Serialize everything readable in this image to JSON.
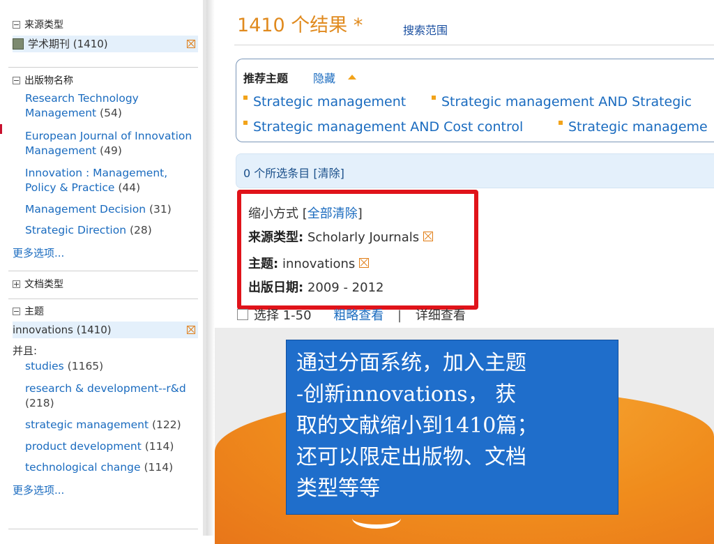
{
  "sidebar": {
    "source_type": {
      "heading": "来源类型",
      "selected": "学术期刊 (1410)"
    },
    "publication": {
      "heading": "出版物名称",
      "items": [
        {
          "label": "Research Technology Management",
          "count": "(54)"
        },
        {
          "label": "European Journal of Innovation Management",
          "count": "(49)"
        },
        {
          "label": "Innovation : Management, Policy & Practice",
          "count": "(44)"
        },
        {
          "label": "Management Decision",
          "count": "(31)"
        },
        {
          "label": "Strategic Direction",
          "count": "(28)"
        }
      ],
      "more": "更多选项..."
    },
    "doc_type": {
      "heading": "文档类型"
    },
    "subject": {
      "heading": "主题",
      "selected": "innovations (1410)",
      "and_label": "并且:",
      "items": [
        {
          "label": "studies",
          "count": "(1165)"
        },
        {
          "label": "research & development--r&d",
          "count": "(218)"
        },
        {
          "label": "strategic management",
          "count": "(122)"
        },
        {
          "label": "product development",
          "count": "(114)"
        },
        {
          "label": "technological change",
          "count": "(114)"
        }
      ],
      "more": "更多选项..."
    }
  },
  "main": {
    "results_count": "1410 个结果 *",
    "search_scope": "搜索范围",
    "recommended": {
      "title": "推荐主题",
      "hide": "隐藏",
      "topics": [
        "Strategic management",
        "Strategic management AND Strategic",
        "Strategic management AND Cost control",
        "Strategic manageme"
      ]
    },
    "selected_items": "0 个所选条目 [清除]",
    "narrow": {
      "title_prefix": "缩小方式 [",
      "clear_all": "全部清除",
      "title_suffix": "]",
      "source_type_label": "来源类型:",
      "source_type_value": "Scholarly Journals",
      "subject_label": "主题:",
      "subject_value": "innovations",
      "date_label": "出版日期:",
      "date_value": "2009 - 2012"
    },
    "select_range": "选择 1-50",
    "brief_view": "粗略查看",
    "separator": "|",
    "detailed_view": "详细查看"
  },
  "callout": {
    "line1": "通过分面系统，加入主题",
    "line2": "-创新innovations， 获",
    "line3": "取的文献缩小到1410篇；",
    "line4": "还可以限定出版物、文档",
    "line5": "类型等等"
  },
  "colors": {
    "accent_orange": "#e08a1e",
    "link_blue": "#1a6bbf",
    "highlight_red": "#e0131a",
    "callout_blue": "#1f6ecb"
  }
}
